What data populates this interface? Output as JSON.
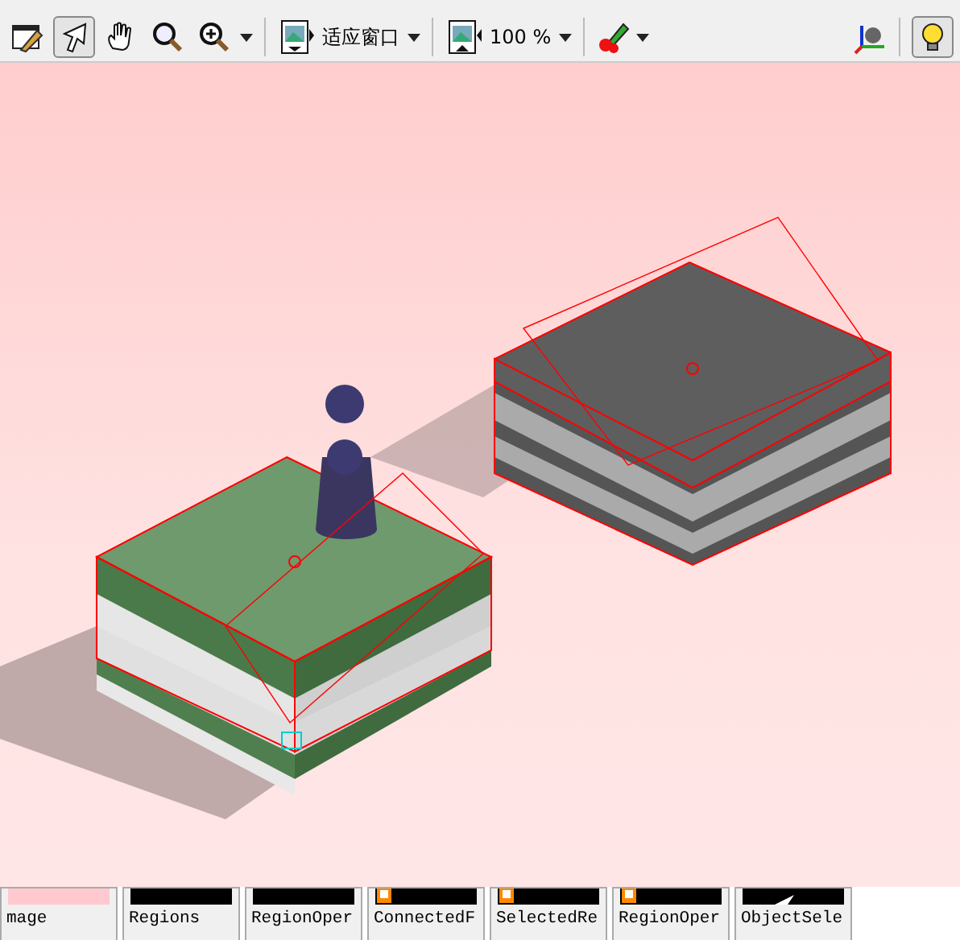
{
  "toolbar": {
    "tools": [
      {
        "kind": "edit",
        "selected": false
      },
      {
        "kind": "pointer",
        "selected": true
      },
      {
        "kind": "hand",
        "selected": false
      },
      {
        "kind": "magnifier",
        "selected": false
      },
      {
        "kind": "zoom",
        "selected": false
      }
    ],
    "fit_dropdown": {
      "value": "适应窗口"
    },
    "zoom_dropdown": {
      "value": "100 %"
    },
    "lighting_toggle": {
      "on": true
    }
  },
  "thumbnails": [
    {
      "label": "mage",
      "kind": "image"
    },
    {
      "label": "Regions",
      "kind": "region"
    },
    {
      "label": "RegionOper",
      "kind": "region"
    },
    {
      "label": "ConnectedF",
      "kind": "region_flagged"
    },
    {
      "label": "SelectedRe",
      "kind": "region_flagged"
    },
    {
      "label": "RegionOper",
      "kind": "region_flagged"
    },
    {
      "label": "ObjectSele",
      "kind": "object"
    }
  ]
}
